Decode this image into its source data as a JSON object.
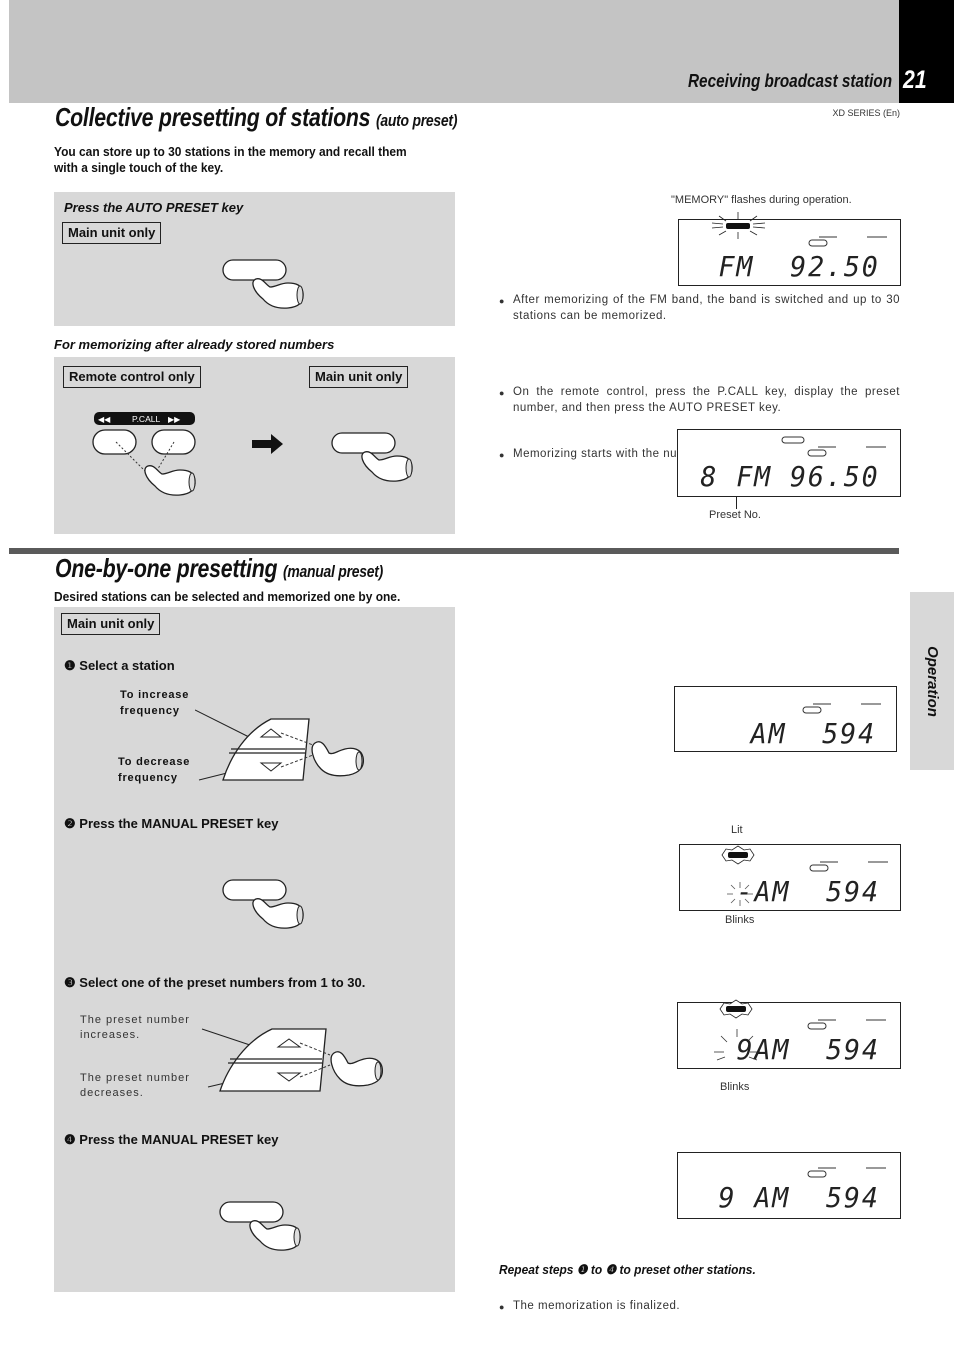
{
  "header": {
    "running_head": "Receiving broadcast station",
    "page_number": "21",
    "series_label": "XD SERIES (En)"
  },
  "side_tab": {
    "label": "Operation"
  },
  "auto_preset": {
    "title": "Collective presetting of stations",
    "subtitle": "(auto preset)",
    "lead": [
      "You can store up to 30 stations in the memory and recall them",
      "with a single touch of the key."
    ],
    "step_heading": "Press the AUTO PRESET key",
    "main_unit_label": "Main unit only",
    "stored_heading": "For memorizing after already stored numbers",
    "remote_label": "Remote control only",
    "main_unit_label_2": "Main unit only",
    "pcall_label": "P.CALL",
    "memory_caption": "\"MEMORY\" flashes during operation.",
    "display_1": {
      "band": "FM",
      "frequency": "92.50"
    },
    "note_1": "After memorizing of the FM band, the band is switched and up to 30 stations can be memorized.",
    "note_2": "On the remote control, press the P.CALL key, display the preset number, and then press the AUTO PRESET key.",
    "note_3": "Memorizing starts with the number following the one being displayed.",
    "display_2": {
      "preset": "8",
      "band": "FM",
      "frequency": "96.50"
    },
    "preset_no_caption": "Preset No."
  },
  "manual_preset": {
    "title": "One-by-one presetting",
    "subtitle": "(manual preset)",
    "lead": "Desired stations can be selected and memorized one by one.",
    "main_unit_label": "Main unit only",
    "steps": [
      {
        "num": "❶",
        "label": "Select a station"
      },
      {
        "num": "❷",
        "label": "Press the MANUAL PRESET key"
      },
      {
        "num": "❸",
        "label": "Select one of the preset numbers from 1 to 30."
      },
      {
        "num": "❹",
        "label": "Press the MANUAL PRESET key"
      }
    ],
    "increase_freq": [
      "To increase",
      "frequency"
    ],
    "decrease_freq": [
      "To decrease",
      "frequency"
    ],
    "preset_increase": [
      "The preset number",
      "increases."
    ],
    "preset_decrease": [
      "The preset number",
      "decreases."
    ],
    "display_step1": {
      "band": "AM",
      "frequency": "594"
    },
    "display_step2": {
      "preset": "-",
      "band": "AM",
      "frequency": "594"
    },
    "lit_caption": "Lit",
    "blinks_caption": "Blinks",
    "display_step3": {
      "preset": "9",
      "band": "AM",
      "frequency": "594"
    },
    "blinks_caption_2": "Blinks",
    "display_step4": {
      "preset": "9",
      "band": "AM",
      "frequency": "594"
    },
    "final_note": "The memorization is finalized.",
    "repeat_pre": "Repeat steps",
    "repeat_from": "❶",
    "repeat_to_word": "to",
    "repeat_to": "❹",
    "repeat_post": "to preset other stations."
  }
}
